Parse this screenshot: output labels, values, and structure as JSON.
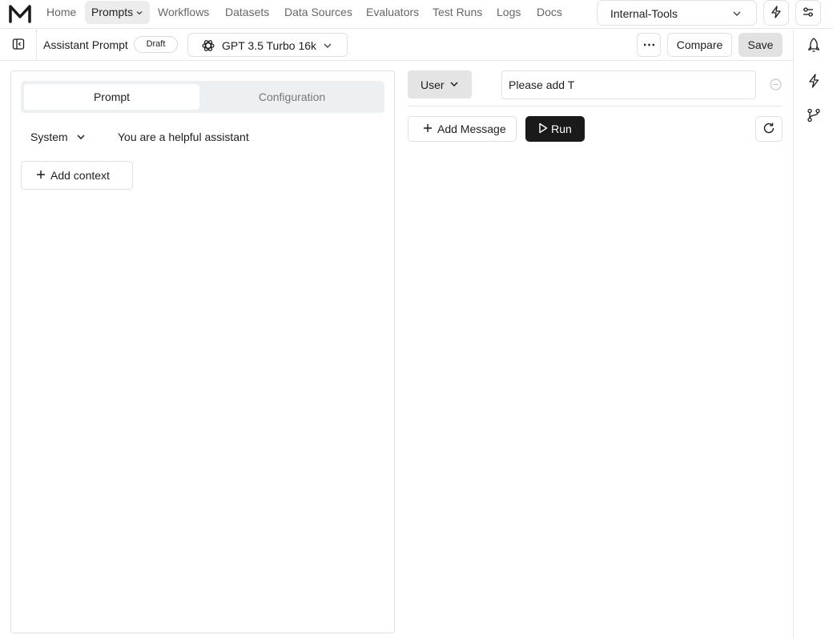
{
  "nav": {
    "items": [
      {
        "label": "Home"
      },
      {
        "label": "Prompts"
      },
      {
        "label": "Workflows"
      },
      {
        "label": "Datasets"
      },
      {
        "label": "Data Sources"
      },
      {
        "label": "Evaluators"
      },
      {
        "label": "Test Runs"
      },
      {
        "label": "Logs"
      },
      {
        "label": "Docs"
      }
    ],
    "active": "Prompts",
    "workspace": "Internal-Tools"
  },
  "prompt": {
    "title": "Assistant Prompt",
    "status": "Draft",
    "model": "GPT 3.5 Turbo 16k"
  },
  "toolbar": {
    "more_label": "⋯",
    "compare_label": "Compare",
    "save_label": "Save"
  },
  "left_panel": {
    "tabs": [
      {
        "label": "Prompt"
      },
      {
        "label": "Configuration"
      }
    ],
    "active_tab": "Prompt",
    "system_role": "System",
    "system_message": "You are a helpful assistant",
    "add_context_label": "Add context"
  },
  "right_panel": {
    "role": "User",
    "message_value": "Please add T",
    "add_message_label": "Add Message",
    "run_label": "Run"
  },
  "icons": {
    "logo": "maxim-logo",
    "workspace_chevron": "chevron-down-icon",
    "lightning": "lightning-icon",
    "settings": "sliders-icon",
    "sidebar_toggle": "sidebar-toggle-icon",
    "model": "openai-icon",
    "rail": [
      "rocket-icon",
      "lightning-icon",
      "git-branch-icon"
    ]
  }
}
